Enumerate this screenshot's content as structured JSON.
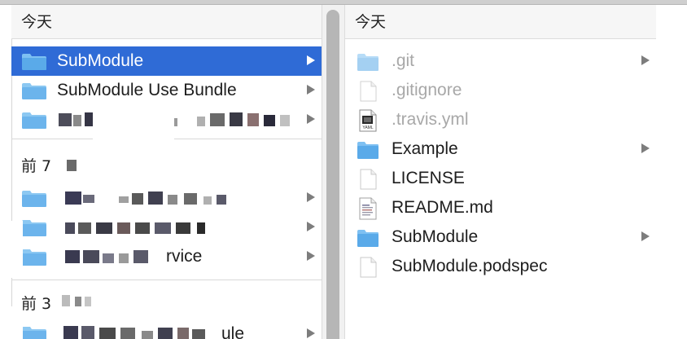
{
  "left_column": {
    "sections": [
      {
        "header": "今天"
      },
      {
        "header": "前 7 "
      },
      {
        "header": "前 3"
      }
    ],
    "items_today": [
      {
        "label": "SubModule",
        "icon": "folder-icon",
        "selected": true
      },
      {
        "label": "SubModule Use Bundle",
        "icon": "folder-icon",
        "selected": false
      },
      {
        "label": "",
        "icon": "folder-icon",
        "selected": false
      }
    ],
    "items_week": [
      {
        "label": "",
        "icon": "folder-icon"
      },
      {
        "label": "",
        "icon": "folder-icon"
      },
      {
        "label": "rvice",
        "icon": "folder-icon"
      }
    ],
    "items_month": [
      {
        "label": "ule",
        "icon": "folder-icon"
      }
    ]
  },
  "right_column": {
    "header": "今天",
    "items": [
      {
        "label": ".git",
        "icon": "folder-icon",
        "hidden": true,
        "has_children": true
      },
      {
        "label": ".gitignore",
        "icon": "document-icon",
        "hidden": true,
        "has_children": false
      },
      {
        "label": ".travis.yml",
        "icon": "yaml-file-icon",
        "hidden": true,
        "has_children": false
      },
      {
        "label": "Example",
        "icon": "folder-icon",
        "hidden": false,
        "has_children": true
      },
      {
        "label": "LICENSE",
        "icon": "document-icon",
        "hidden": false,
        "has_children": false
      },
      {
        "label": "README.md",
        "icon": "text-file-icon",
        "hidden": false,
        "has_children": false
      },
      {
        "label": "SubModule",
        "icon": "folder-icon",
        "hidden": false,
        "has_children": true
      },
      {
        "label": "SubModule.podspec",
        "icon": "document-icon",
        "hidden": false,
        "has_children": false
      }
    ],
    "yaml_badge": "YAML"
  },
  "colors": {
    "selection": "#2f6bd6",
    "folder": "#6cb4ec",
    "hidden_text": "#a8a8a8"
  }
}
